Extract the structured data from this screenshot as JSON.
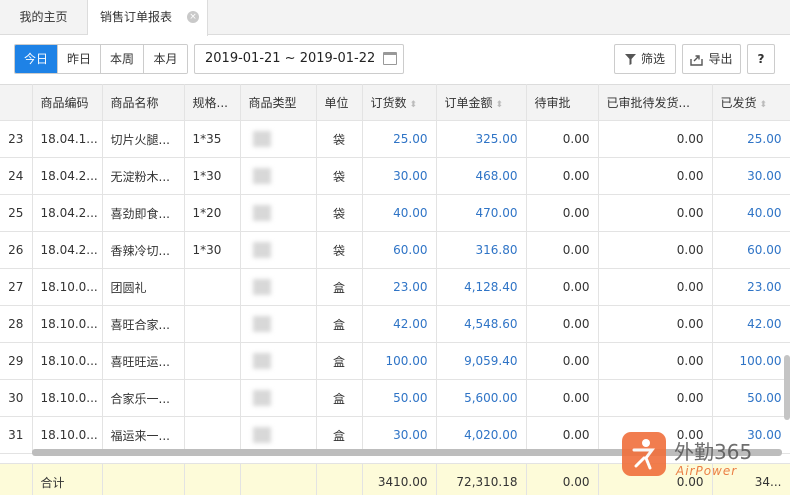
{
  "tabs": {
    "home": "我的主页",
    "active": "销售订单报表",
    "close_glyph": "×"
  },
  "toolbar": {
    "periods": [
      "今日",
      "昨日",
      "本周",
      "本月"
    ],
    "date_range": "2019-01-21 ~ 2019-01-22",
    "filter_label": "筛选",
    "export_label": "导出",
    "help_label": "?"
  },
  "table": {
    "columns": [
      "",
      "商品编码",
      "商品名称",
      "规格...",
      "商品类型",
      "单位",
      "订货数",
      "订单金额",
      "待审批",
      "已审批待发货...",
      "已发货"
    ],
    "rows": [
      {
        "idx": "23",
        "code": "18.04.1...",
        "name": "切片火腿...",
        "spec": "1*35",
        "unit": "袋",
        "qty": "25.00",
        "amount": "325.00",
        "pending": "0.00",
        "approved": "0.00",
        "shipped": "25.00"
      },
      {
        "idx": "24",
        "code": "18.04.2...",
        "name": "无淀粉木...",
        "spec": "1*30",
        "unit": "袋",
        "qty": "30.00",
        "amount": "468.00",
        "pending": "0.00",
        "approved": "0.00",
        "shipped": "30.00"
      },
      {
        "idx": "25",
        "code": "18.04.2...",
        "name": "喜劲即食...",
        "spec": "1*20",
        "unit": "袋",
        "qty": "40.00",
        "amount": "470.00",
        "pending": "0.00",
        "approved": "0.00",
        "shipped": "40.00"
      },
      {
        "idx": "26",
        "code": "18.04.2...",
        "name": "香辣冷切...",
        "spec": "1*30",
        "unit": "袋",
        "qty": "60.00",
        "amount": "316.80",
        "pending": "0.00",
        "approved": "0.00",
        "shipped": "60.00"
      },
      {
        "idx": "27",
        "code": "18.10.0...",
        "name": "团圆礼",
        "spec": "",
        "unit": "盒",
        "qty": "23.00",
        "amount": "4,128.40",
        "pending": "0.00",
        "approved": "0.00",
        "shipped": "23.00"
      },
      {
        "idx": "28",
        "code": "18.10.0...",
        "name": "喜旺合家...",
        "spec": "",
        "unit": "盒",
        "qty": "42.00",
        "amount": "4,548.60",
        "pending": "0.00",
        "approved": "0.00",
        "shipped": "42.00"
      },
      {
        "idx": "29",
        "code": "18.10.0...",
        "name": "喜旺旺运...",
        "spec": "",
        "unit": "盒",
        "qty": "100.00",
        "amount": "9,059.40",
        "pending": "0.00",
        "approved": "0.00",
        "shipped": "100.00"
      },
      {
        "idx": "30",
        "code": "18.10.0...",
        "name": "合家乐一...",
        "spec": "",
        "unit": "盒",
        "qty": "50.00",
        "amount": "5,600.00",
        "pending": "0.00",
        "approved": "0.00",
        "shipped": "50.00"
      },
      {
        "idx": "31",
        "code": "18.10.0...",
        "name": "福运来一...",
        "spec": "",
        "unit": "盒",
        "qty": "30.00",
        "amount": "4,020.00",
        "pending": "0.00",
        "approved": "0.00",
        "shipped": "30.00"
      }
    ],
    "footer": {
      "label": "合计",
      "qty": "3410.00",
      "amount": "72,310.18",
      "pending": "0.00",
      "approved": "0.00",
      "shipped": "34..."
    }
  },
  "watermark": {
    "brand": "外勤365",
    "sub": "AirPower"
  },
  "colors": {
    "accent": "#1e82e6",
    "link": "#2f74c6",
    "footer_bg": "#fdfbd9",
    "header_bg": "#f3f3f3"
  }
}
